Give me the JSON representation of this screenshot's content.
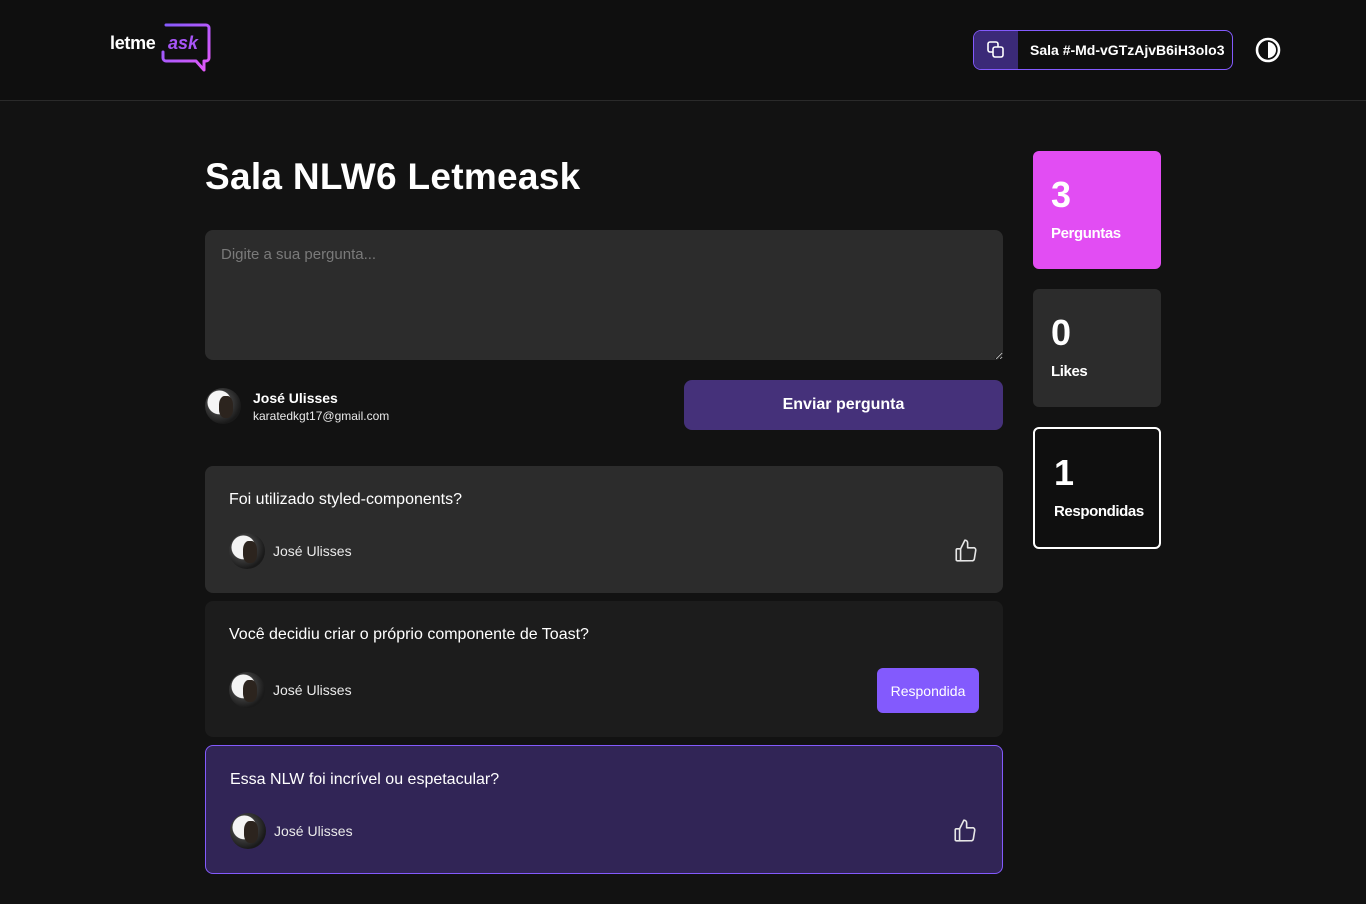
{
  "header": {
    "logo": {
      "text_primary": "letme",
      "text_secondary": "ask"
    },
    "room_code": {
      "label": "Sala #-Md-vGTzAjvB6iH3olo3",
      "copy_icon": "copy-icon"
    },
    "theme_toggle_icon": "contrast-icon"
  },
  "main": {
    "title": "Sala NLW6 Letmeask",
    "question_input": {
      "placeholder": "Digite a sua pergunta...",
      "value": ""
    },
    "user": {
      "name": "José Ulisses",
      "email": "karatedkgt17@gmail.com"
    },
    "send_button_label": "Enviar pergunta",
    "questions": [
      {
        "text": "Foi utilizado styled-components?",
        "author": "José Ulisses",
        "status": "default",
        "action_icon": "thumbs-up-icon"
      },
      {
        "text": "Você decidiu criar o próprio componente de Toast?",
        "author": "José Ulisses",
        "status": "answered",
        "action_label": "Respondida"
      },
      {
        "text": "Essa NLW foi incrível ou espetacular?",
        "author": "José Ulisses",
        "status": "highlighted",
        "action_icon": "thumbs-up-icon"
      }
    ]
  },
  "stats": [
    {
      "value": "3",
      "label": "Perguntas",
      "color": "#e24df3"
    },
    {
      "value": "0",
      "label": "Likes",
      "color": "#2c2c2c"
    },
    {
      "value": "1",
      "label": "Respondidas",
      "color": "#0f0f0f"
    }
  ],
  "colors": {
    "accent": "#835afd",
    "send_button": "#45317a",
    "highlight_bg": "#312556",
    "background": "#121212"
  }
}
